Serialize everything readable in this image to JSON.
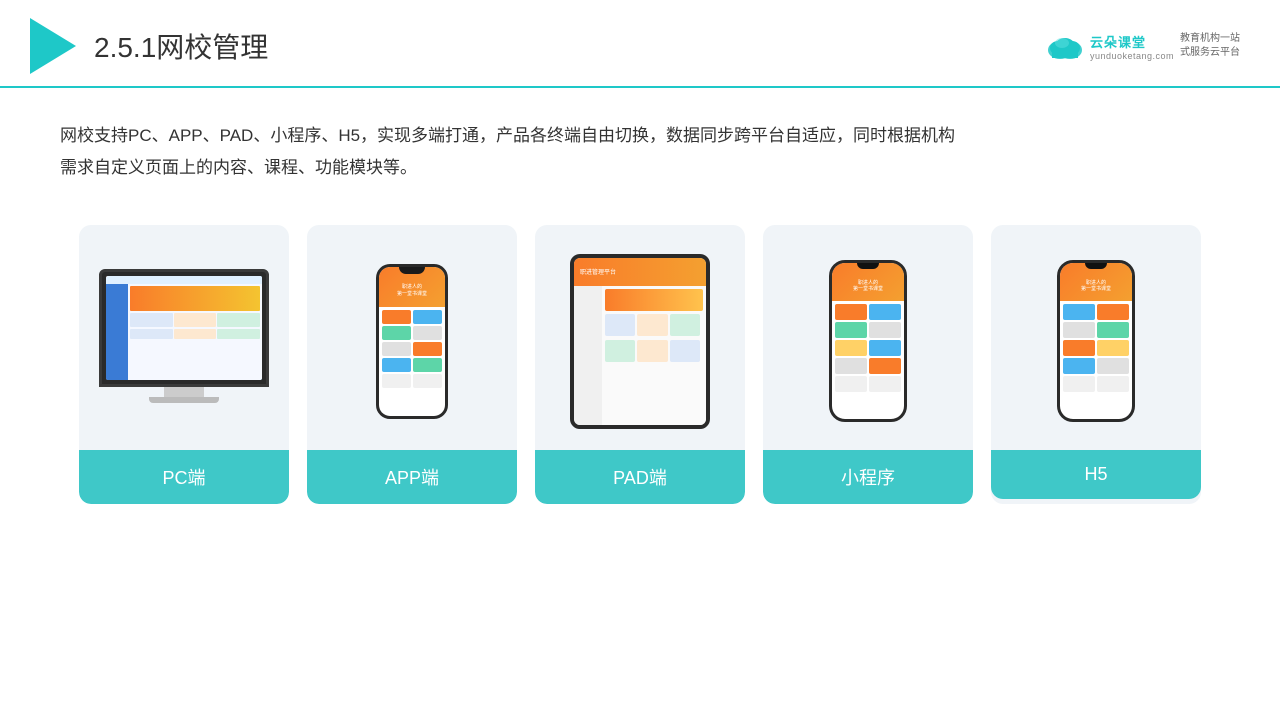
{
  "header": {
    "title_prefix": "2.5.1",
    "title_main": "网校管理",
    "brand_name": "云朵课堂",
    "brand_url": "yunduoketang.com",
    "brand_slogan_line1": "教育机构一站",
    "brand_slogan_line2": "式服务云平台"
  },
  "description": {
    "line1": "网校支持PC、APP、PAD、小程序、H5，实现多端打通，产品各终端自由切换，数据同步跨平台自适应，同时根据机构",
    "line2": "需求自定义页面上的内容、课程、功能模块等。"
  },
  "cards": [
    {
      "label": "PC端",
      "type": "pc"
    },
    {
      "label": "APP端",
      "type": "phone"
    },
    {
      "label": "PAD端",
      "type": "tablet"
    },
    {
      "label": "小程序",
      "type": "phone-small"
    },
    {
      "label": "H5",
      "type": "phone-small2"
    }
  ]
}
